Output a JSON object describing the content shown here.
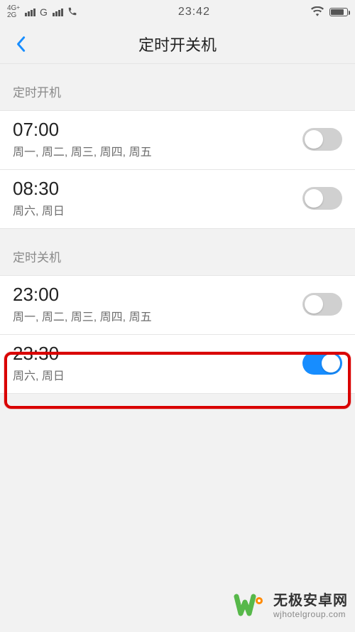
{
  "status": {
    "net1_label": "4G",
    "net1_sup": "+",
    "net2_label": "2G",
    "secondary_label": "G",
    "time": "23:42"
  },
  "nav": {
    "title": "定时开关机"
  },
  "sections": [
    {
      "header": "定时开机",
      "rows": [
        {
          "time": "07:00",
          "days": "周一, 周二, 周三, 周四, 周五",
          "enabled": false
        },
        {
          "time": "08:30",
          "days": "周六, 周日",
          "enabled": false
        }
      ]
    },
    {
      "header": "定时关机",
      "rows": [
        {
          "time": "23:00",
          "days": "周一, 周二, 周三, 周四, 周五",
          "enabled": false
        },
        {
          "time": "23:30",
          "days": "周六, 周日",
          "enabled": true
        }
      ]
    }
  ],
  "watermark": {
    "title": "无极安卓网",
    "sub": "wjhotelgroup.com"
  },
  "colors": {
    "accent": "#178dff",
    "highlight": "#d90000"
  }
}
